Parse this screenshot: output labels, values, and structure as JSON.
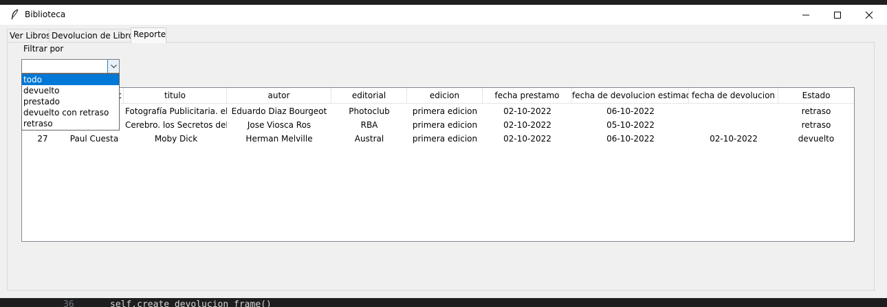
{
  "window": {
    "title": "Biblioteca"
  },
  "tabs": [
    {
      "label": "Ver Libros"
    },
    {
      "label": "Devolucion de Libros"
    },
    {
      "label": "Reporte"
    }
  ],
  "filter": {
    "label": "Filtrar por",
    "value": "",
    "options": [
      "todo",
      "devuelto",
      "prestado",
      "devuelto con retraso",
      "retraso"
    ],
    "highlighted": "todo"
  },
  "table": {
    "columns": [
      "c",
      "titulo",
      "autor",
      "editorial",
      "edicion",
      "fecha prestamo",
      "fecha de devolucion estimada",
      "fecha de devolucion",
      "Estado"
    ],
    "rows": [
      [
        "",
        "",
        "Fotografía Publicitaria. el P",
        "Eduardo Diaz Bourgeot",
        "Photoclub",
        "primera edicion",
        "02-10-2022",
        "06-10-2022",
        "",
        "retraso"
      ],
      [
        "",
        "",
        "Cerebro. los Secretos del Ó",
        "Jose Viosca Ros",
        "RBA",
        "primera edicion",
        "02-10-2022",
        "05-10-2022",
        "",
        "retraso"
      ],
      [
        "27",
        "Paul Cuesta",
        "Moby Dick",
        "Herman Melville",
        "Austral",
        "primera edicion",
        "02-10-2022",
        "06-10-2022",
        "02-10-2022",
        "devuelto"
      ]
    ]
  },
  "editor_behind": {
    "line_number": "36",
    "code": "self.create_devolucion_frame()"
  },
  "colors": {
    "selection": "#0078d7",
    "window_bg": "#f0f0f0"
  }
}
